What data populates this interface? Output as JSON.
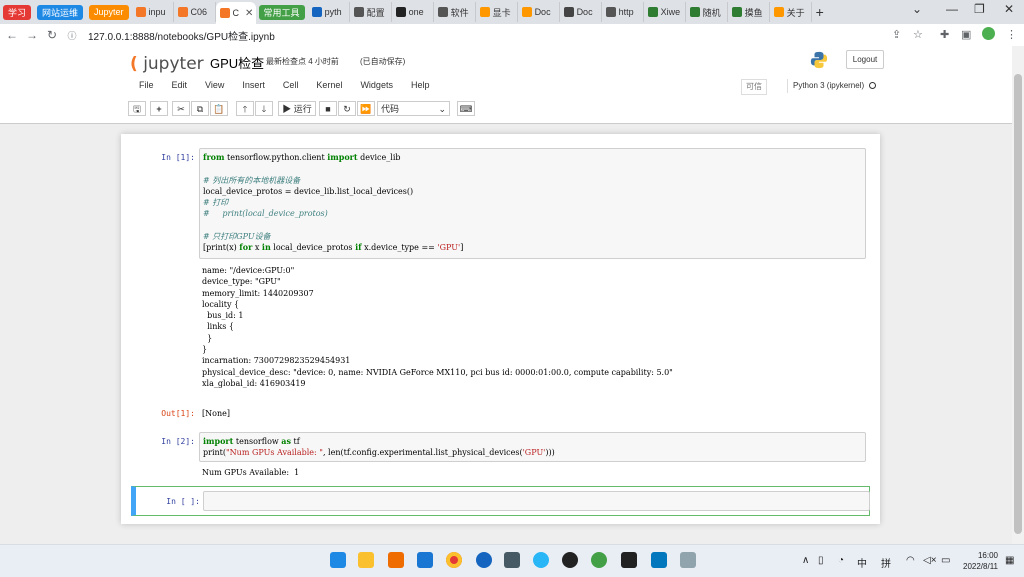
{
  "browser": {
    "tabs": [
      {
        "label": "学习",
        "kind": "pill",
        "color": "#e53935"
      },
      {
        "label": "网站运维",
        "kind": "pill",
        "color": "#1e88e5"
      },
      {
        "label": "Jupyter",
        "kind": "pill",
        "color": "#fb8c00"
      },
      {
        "label": "inpu",
        "kind": "norm",
        "color": "#f37726"
      },
      {
        "label": "C06",
        "kind": "norm",
        "color": "#f37726"
      },
      {
        "label": "C",
        "kind": "active",
        "color": "#f37726"
      },
      {
        "label": "常用工具",
        "kind": "pill",
        "color": "#43a047"
      },
      {
        "label": "pyth",
        "kind": "norm",
        "color": "#1565c0"
      },
      {
        "label": "配置",
        "kind": "norm",
        "color": "#555555"
      },
      {
        "label": "one",
        "kind": "norm",
        "color": "#222222"
      },
      {
        "label": "软件",
        "kind": "norm",
        "color": "#555555"
      },
      {
        "label": "显卡",
        "kind": "norm",
        "color": "#ff9800"
      },
      {
        "label": "Doc",
        "kind": "norm",
        "color": "#ff9800"
      },
      {
        "label": "Doc",
        "kind": "norm",
        "color": "#444444"
      },
      {
        "label": "http",
        "kind": "norm",
        "color": "#555555"
      },
      {
        "label": "Xiwe",
        "kind": "norm",
        "color": "#2e7d32"
      },
      {
        "label": "随机",
        "kind": "norm",
        "color": "#2e7d32"
      },
      {
        "label": "摸鱼",
        "kind": "norm",
        "color": "#2e7d32"
      },
      {
        "label": "关于",
        "kind": "norm",
        "color": "#ff9800"
      }
    ],
    "new_tab": "+",
    "url": "127.0.0.1:8888/notebooks/GPU检查.ipynb"
  },
  "jupyter": {
    "logo_text": "jupyter",
    "notebook_title": "GPU检查",
    "checkpoint": "最新检查点 4 小时前",
    "autosave": "(已自动保存)",
    "logout": "Logout",
    "menu": [
      "File",
      "Edit",
      "View",
      "Insert",
      "Cell",
      "Kernel",
      "Widgets",
      "Help"
    ],
    "trusted": "可信",
    "kernel_name": "Python 3 (ipykernel)",
    "toolbar": {
      "run_label": "运行",
      "cell_type": "代码"
    }
  },
  "cells": {
    "cell1": {
      "in_prompt": "In  [1]:",
      "out_prompt": "Out[1]:",
      "stream": "name: \"/device:GPU:0\"\ndevice_type: \"GPU\"\nmemory_limit: 1440209307\nlocality {\n  bus_id: 1\n  links {\n  }\n}\nincarnation: 7300729823529454931\nphysical_device_desc: \"device: 0, name: NVIDIA GeForce MX110, pci bus id: 0000:01:00.0, compute capability: 5.0\"\nxla_global_id: 416903419",
      "result": "[None]"
    },
    "cell2": {
      "in_prompt": "In  [2]:",
      "stream": "Num GPUs Available:  1"
    },
    "cell3": {
      "in_prompt": "In  [  ]:"
    }
  },
  "taskbar": {
    "ime": "中",
    "ime2": "拼",
    "time": "16:00",
    "date": "2022/8/11"
  }
}
